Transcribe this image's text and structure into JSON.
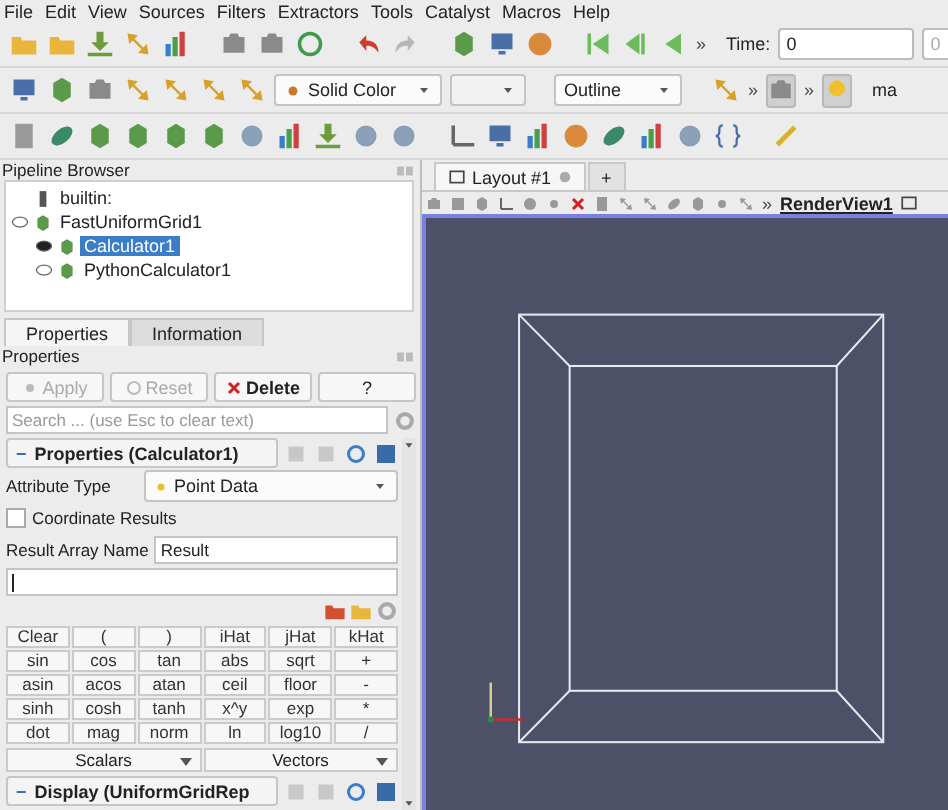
{
  "menu": [
    "File",
    "Edit",
    "View",
    "Sources",
    "Filters",
    "Extractors",
    "Tools",
    "Catalyst",
    "Macros",
    "Help"
  ],
  "toolbar_1": {
    "more": "»",
    "time_label": "Time:",
    "time_value": "0",
    "time_index": "0"
  },
  "toolbar_2": {
    "color_by": "Solid Color",
    "representation": "Outline",
    "more_1": "»",
    "more_2": "»",
    "cut_label": "ma"
  },
  "pipeline_browser": {
    "title": "Pipeline Browser",
    "server": "builtin:",
    "items": [
      {
        "label": "FastUniformGrid1",
        "visible": false,
        "selected": false,
        "children": [
          {
            "label": "Calculator1",
            "visible": true,
            "selected": true
          },
          {
            "label": "PythonCalculator1",
            "visible": false,
            "selected": false
          }
        ]
      }
    ]
  },
  "tabs": [
    {
      "label": "Properties",
      "selected": true
    },
    {
      "label": "Information",
      "selected": false
    }
  ],
  "properties": {
    "title": "Properties",
    "buttons": [
      {
        "label": "Apply",
        "kind": "apply",
        "disabled": true
      },
      {
        "label": "Reset",
        "kind": "reset",
        "disabled": true
      },
      {
        "label": "Delete",
        "kind": "delete",
        "disabled": false
      },
      {
        "label": "?",
        "kind": "help",
        "disabled": false
      }
    ],
    "search_placeholder": "Search ... (use Esc to clear text)",
    "section": {
      "toggle": "−",
      "title": "Properties (Calculator1)"
    },
    "attribute_type": {
      "label": "Attribute Type",
      "value": "Point Data"
    },
    "coordinate_results": {
      "label": "Coordinate Results",
      "checked": false
    },
    "result_array": {
      "label": "Result Array Name",
      "value": "Result"
    },
    "calculator_keys": [
      [
        "Clear",
        "(",
        ")",
        "iHat",
        "jHat",
        "kHat"
      ],
      [
        "sin",
        "cos",
        "tan",
        "abs",
        "sqrt",
        "+"
      ],
      [
        "asin",
        "acos",
        "atan",
        "ceil",
        "floor",
        "-"
      ],
      [
        "sinh",
        "cosh",
        "tanh",
        "x^y",
        "exp",
        "*"
      ],
      [
        "dot",
        "mag",
        "norm",
        "ln",
        "log10",
        "/"
      ]
    ],
    "scalars": "Scalars",
    "vectors": "Vectors",
    "display_section": {
      "toggle": "−",
      "title": "Display (UniformGridRep"
    }
  },
  "layout_tabs": [
    {
      "label": "Layout #1",
      "selected": true
    },
    {
      "label": "+",
      "selected": false
    }
  ],
  "render_view": {
    "more": "»",
    "name": "RenderView1"
  }
}
